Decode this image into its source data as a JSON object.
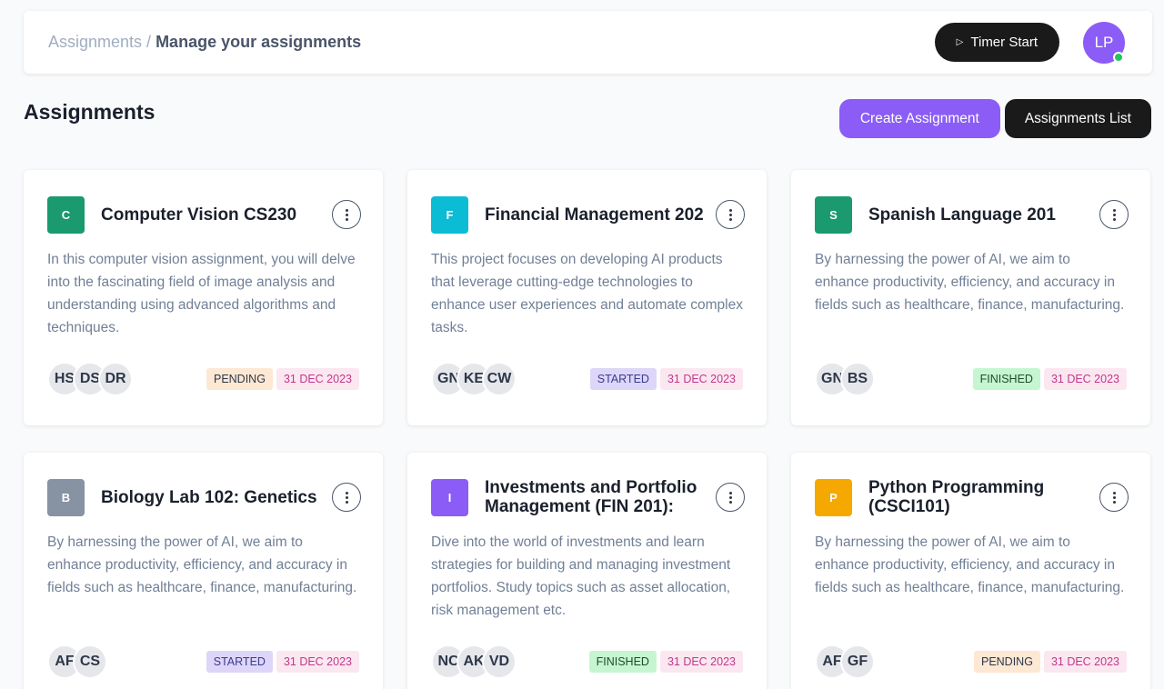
{
  "header": {
    "breadcrumb_root": "Assignments",
    "breadcrumb_sep": "/",
    "breadcrumb_current": "Manage your assignments",
    "timer_label": "Timer Start",
    "user_initials": "LP"
  },
  "page": {
    "title": "Assignments",
    "create_label": "Create Assignment",
    "list_label": "Assignments List"
  },
  "cards": [
    {
      "initial": "C",
      "color": "#1a9a6e",
      "title": "Computer Vision CS230",
      "description": "In this computer vision assignment, you will delve into the fascinating field of image analysis and understanding using advanced algorithms and techniques.",
      "members": [
        "HS",
        "DS",
        "DR"
      ],
      "status": "PENDING",
      "status_class": "pending",
      "date": "31 DEC 2023"
    },
    {
      "initial": "F",
      "color": "#0bbcd4",
      "title": "Financial Management 202",
      "description": "This project focuses on developing AI products that leverage cutting-edge technologies to enhance user experiences and automate complex tasks.",
      "members": [
        "GN",
        "KE",
        "CW"
      ],
      "status": "STARTED",
      "status_class": "started",
      "date": "31 DEC 2023"
    },
    {
      "initial": "S",
      "color": "#1a9a6e",
      "title": "Spanish Language 201",
      "description": "By harnessing the power of AI, we aim to enhance productivity, efficiency, and accuracy in fields such as healthcare, finance, manufacturing.",
      "members": [
        "GN",
        "BS"
      ],
      "status": "FINISHED",
      "status_class": "finished",
      "date": "31 DEC 2023"
    },
    {
      "initial": "B",
      "color": "#8792a2",
      "title": "Biology Lab 102: Genetics",
      "description": "By harnessing the power of AI, we aim to enhance productivity, efficiency, and accuracy in fields such as healthcare, finance, manufacturing.",
      "members": [
        "AF",
        "CS"
      ],
      "status": "STARTED",
      "status_class": "started",
      "date": "31 DEC 2023"
    },
    {
      "initial": "I",
      "color": "#8b5cf6",
      "title": "Investments and Portfolio Management (FIN 201):",
      "description": "Dive into the world of investments and learn strategies for building and managing investment portfolios. Study topics such as asset allocation, risk management etc.",
      "members": [
        "NC",
        "AK",
        "VD"
      ],
      "status": "FINISHED",
      "status_class": "finished",
      "date": "31 DEC 2023"
    },
    {
      "initial": "P",
      "color": "#f5a800",
      "title": "Python Programming (CSCI101)",
      "description": "By harnessing the power of AI, we aim to enhance productivity, efficiency, and accuracy in fields such as healthcare, finance, manufacturing.",
      "members": [
        "AF",
        "GF"
      ],
      "status": "PENDING",
      "status_class": "pending",
      "date": "31 DEC 2023"
    }
  ]
}
